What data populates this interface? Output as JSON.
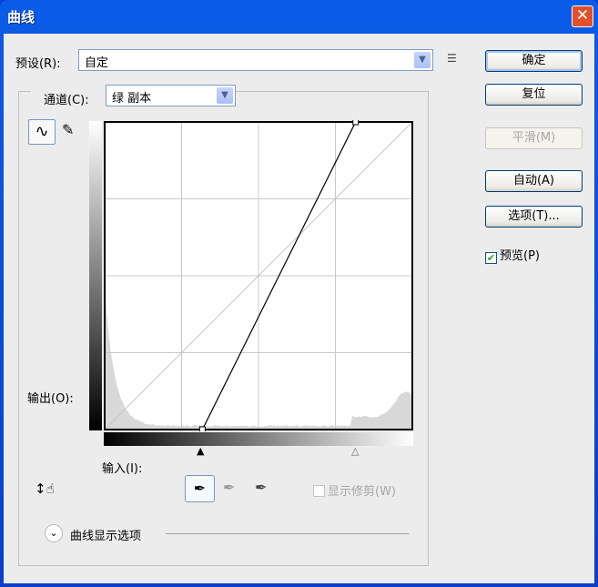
{
  "window": {
    "title": "曲线",
    "close": "✕"
  },
  "preset": {
    "label": "预设(R):",
    "value": "自定"
  },
  "channel": {
    "label": "通道(C):",
    "value": "绿 副本"
  },
  "buttons": {
    "ok": "确定",
    "reset": "复位",
    "smooth": "平滑(M)",
    "auto": "自动(A)",
    "options": "选项(T)..."
  },
  "preview": {
    "label": "预览(P)",
    "checked": true
  },
  "output_label": "输出(O):",
  "input_label": "输入(I):",
  "show_clipping": {
    "label": "显示修剪(W)",
    "checked": false,
    "enabled": false
  },
  "curve_display_options": "曲线显示选项",
  "curve": {
    "points": [
      [
        0,
        0
      ],
      [
        81,
        0
      ],
      [
        208,
        255
      ],
      [
        255,
        255
      ]
    ]
  }
}
